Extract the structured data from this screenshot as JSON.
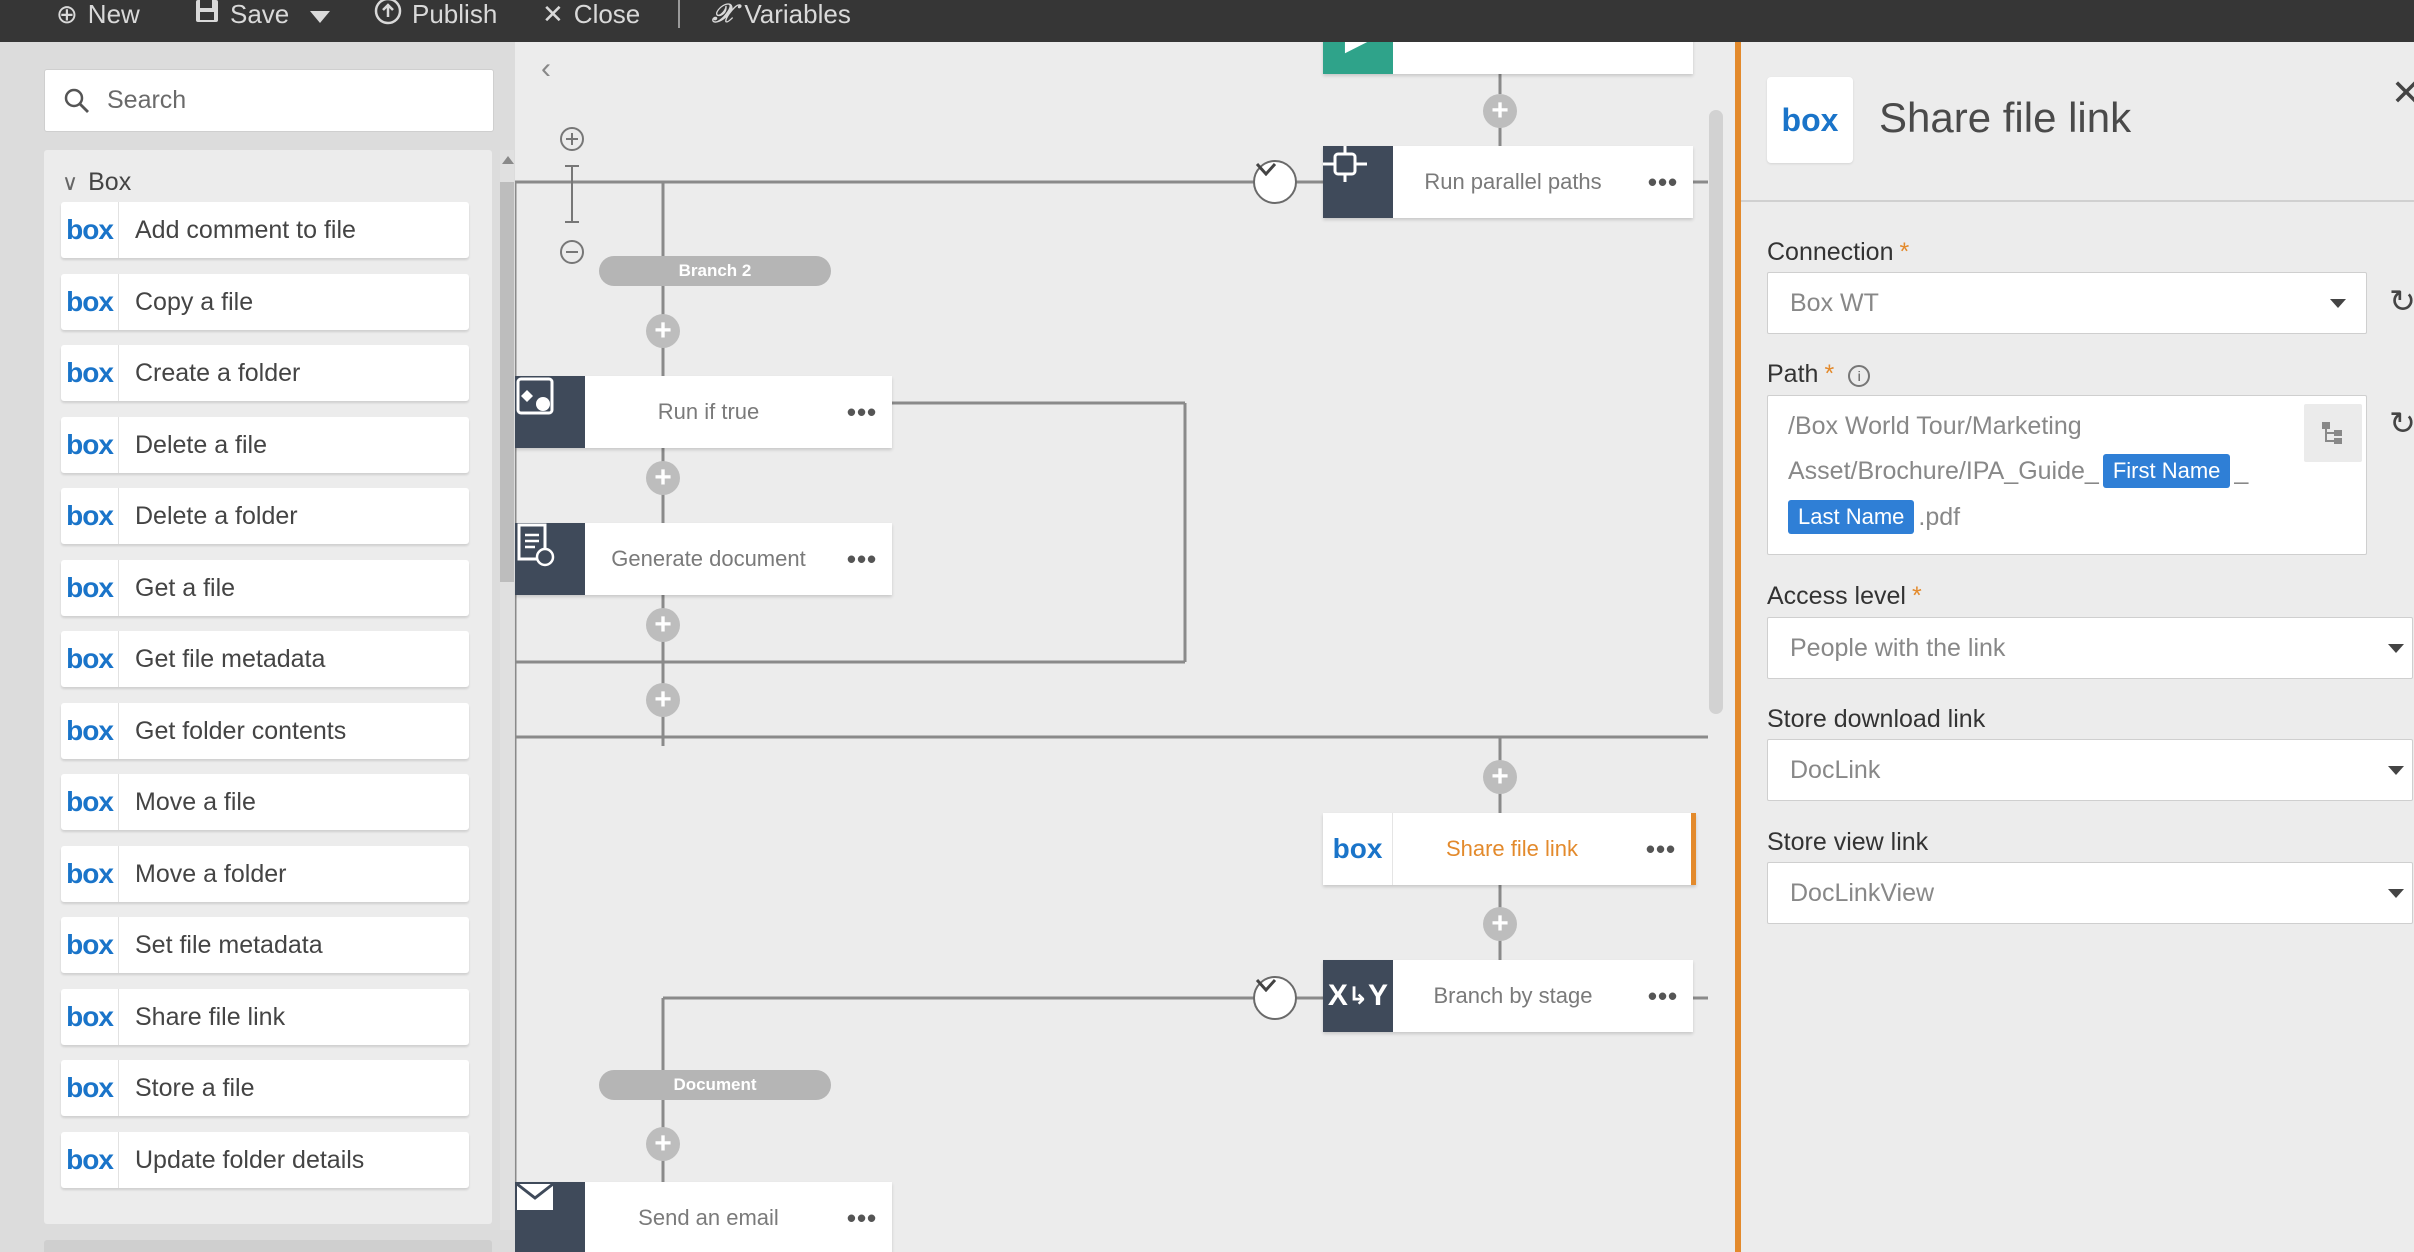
{
  "toolbar": {
    "new_label": "New",
    "save_label": "Save",
    "publish_label": "Publish",
    "close_label": "Close",
    "variables_label": "Variables"
  },
  "left_panel": {
    "search": {
      "placeholder": "Search"
    },
    "group_title": "Box",
    "logo_text": "box",
    "actions": [
      "Add comment to file",
      "Copy a file",
      "Create a folder",
      "Delete a file",
      "Delete a folder",
      "Get a file",
      "Get file metadata",
      "Get folder contents",
      "Move a file",
      "Move a folder",
      "Set file metadata",
      "Share file link",
      "Store a file",
      "Update folder details"
    ]
  },
  "canvas": {
    "nodes": {
      "run_parallel_paths": "Run parallel paths",
      "run_if_true": "Run if true",
      "generate_document": "Generate document",
      "share_file_link": "Share file link",
      "branch_by_stage": "Branch by stage",
      "send_an_email": "Send an email"
    },
    "more_label": "•••",
    "branch_labels": {
      "branch_2": "Branch 2",
      "document": "Document"
    }
  },
  "right_panel": {
    "logo_text": "box",
    "title": "Share file link",
    "connection": {
      "label": "Connection",
      "value": "Box WT"
    },
    "path": {
      "label": "Path",
      "line1": "/Box World Tour/Marketing",
      "line2_prefix": "Asset/Brochure/IPA_Guide_",
      "token_first": "First Name",
      "line2_suffix": "_",
      "token_last": "Last Name",
      "line3_suffix": ".pdf"
    },
    "access_level": {
      "label": "Access level",
      "value": "People with the link"
    },
    "store_download_link": {
      "label": "Store download link",
      "value": "DocLink"
    },
    "store_view_link": {
      "label": "Store view link",
      "value": "DocLinkView"
    }
  },
  "colors": {
    "toolbar_bg": "#363636",
    "box_blue": "#1a74c9",
    "accent_orange": "#e38a2c",
    "token_blue": "#2f7fd6",
    "node_icon_bg": "#3f4a5a"
  }
}
